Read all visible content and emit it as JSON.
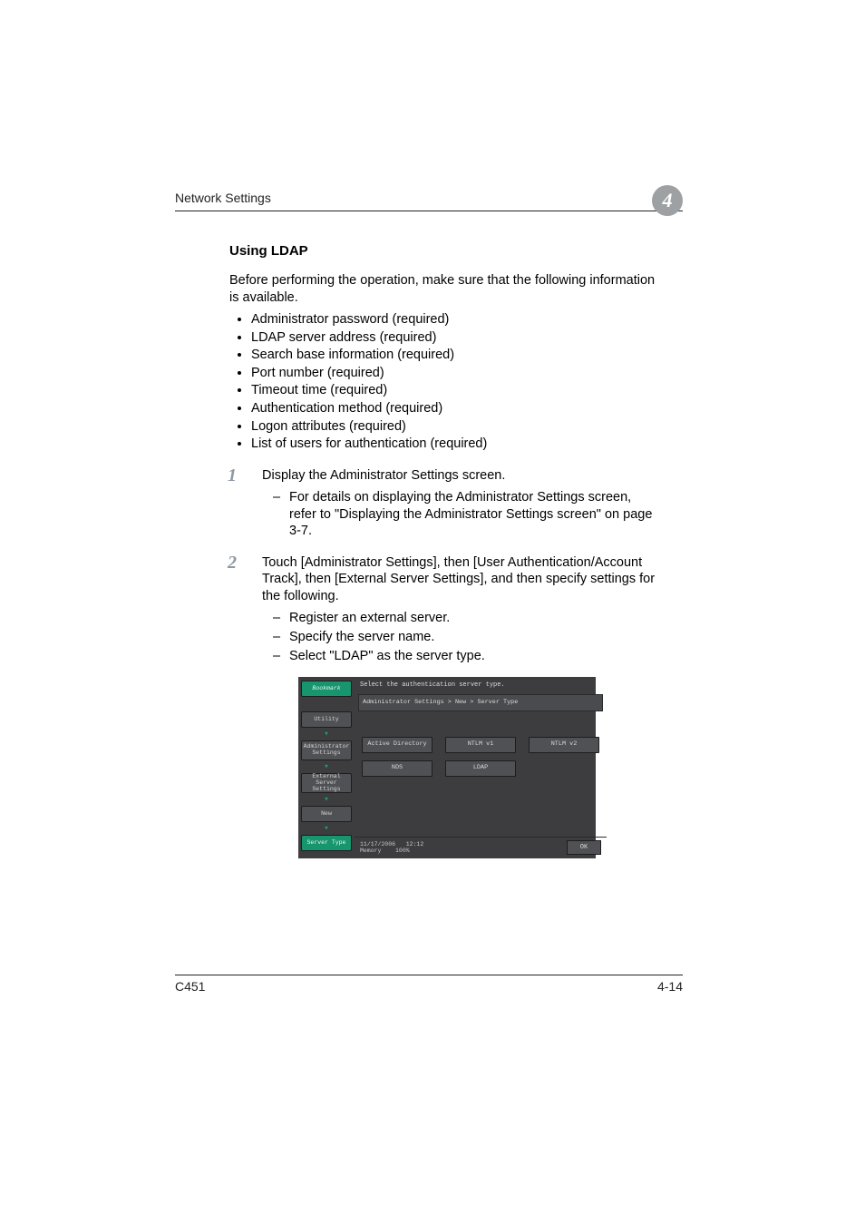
{
  "header": {
    "section": "Network Settings",
    "chapter": "4"
  },
  "heading": "Using LDAP",
  "intro": "Before performing the operation, make sure that the following information is available.",
  "bullets": [
    "Administrator password (required)",
    "LDAP server address (required)",
    "Search base information (required)",
    "Port number (required)",
    "Timeout time (required)",
    "Authentication method (required)",
    "Logon attributes (required)",
    "List of users for authentication (required)"
  ],
  "steps": {
    "s1": {
      "num": "1",
      "text": "Display the Administrator Settings screen.",
      "subs": [
        "For details on displaying the Administrator Settings screen, refer to \"Displaying the Administrator Settings screen\" on page 3-7."
      ]
    },
    "s2": {
      "num": "2",
      "text": "Touch [Administrator Settings], then [User Authentication/Account Track], then [External Server Settings], and then specify settings for the following.",
      "subs": [
        "Register an external server.",
        "Specify the server name.",
        "Select \"LDAP\" as the server type."
      ]
    }
  },
  "screenshot": {
    "title": "Select the authentication server type.",
    "breadcrumb": "Administrator Settings > New > Server Type",
    "side": {
      "bookmark": "Bookmark",
      "utility": "Utility",
      "admin": "Administrator Settings",
      "ext": "External Server Settings",
      "new": "New",
      "server_type": "Server Type"
    },
    "options": {
      "ad": "Active Directory",
      "ntlm1": "NTLM v1",
      "ntlm2": "NTLM v2",
      "nds": "NDS",
      "ldap": "LDAP"
    },
    "status": {
      "date": "11/17/2006",
      "time": "12:12",
      "memory_label": "Memory",
      "memory_value": "100%",
      "ok": "OK"
    }
  },
  "footer": {
    "model": "C451",
    "page": "4-14"
  }
}
